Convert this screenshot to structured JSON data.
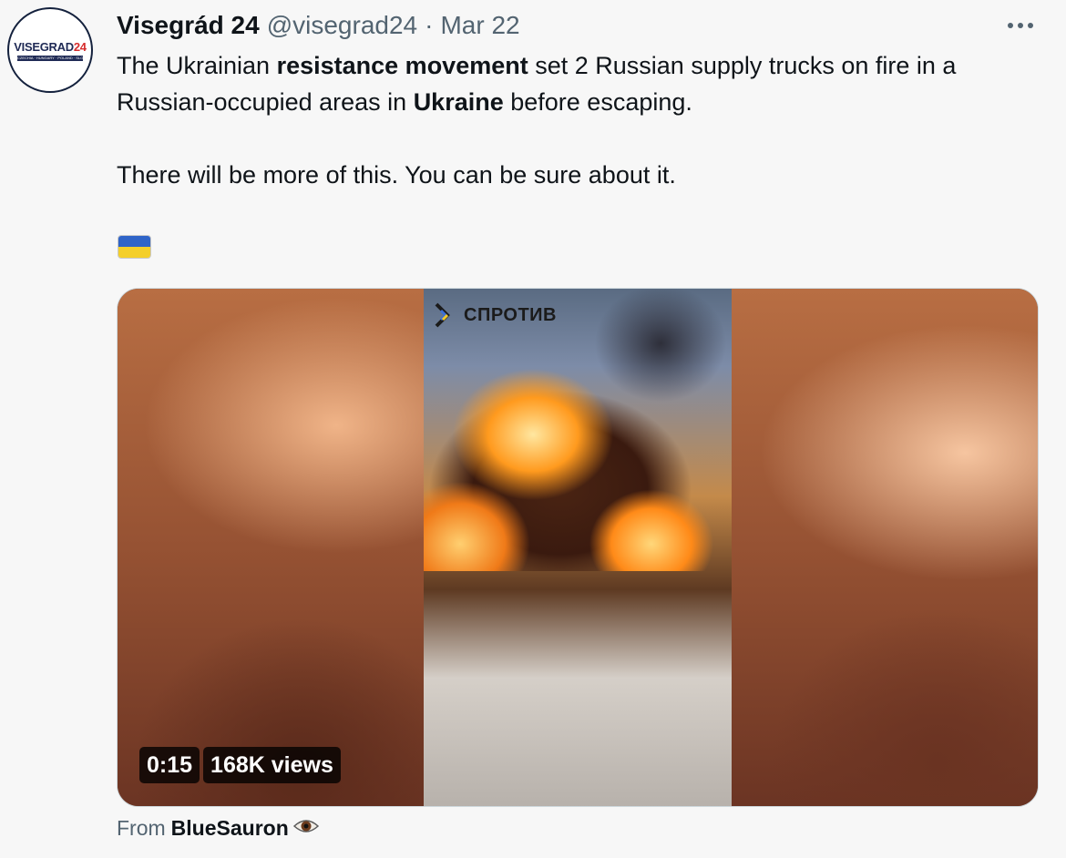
{
  "account": {
    "name": "Visegrád 24",
    "handle": "@visegrad24",
    "separator": "·",
    "date": "Mar 22",
    "avatar_logo_part1": "VISEGRAD",
    "avatar_logo_part2": "24",
    "avatar_sub": "CZECHIA · HUNGARY · POLAND · SLOVAKIA"
  },
  "more_menu_icon": "more-horizontal-icon",
  "tweet": {
    "p1_a": "The Ukrainian ",
    "p1_b": "resistance movement",
    "p1_c": " set 2 Russian supply trucks on fire in a Russian-occupied areas in ",
    "p1_d": "Ukraine",
    "p1_e": " before escaping.",
    "p2": "There will be more of this. You can be sure about it.",
    "flag_emoji": "ukraine-flag-icon"
  },
  "video": {
    "watermark": "СПРОТИВ",
    "duration": "0:15",
    "views": "168K views"
  },
  "attribution": {
    "from_label": "From",
    "user": "BlueSauron",
    "icon": "eye-icon"
  },
  "colors": {
    "text": "#0f1419",
    "secondary": "#536471",
    "background": "#f7f7f7",
    "flag_blue": "#2f64c8",
    "flag_yellow": "#f4cf2a"
  }
}
